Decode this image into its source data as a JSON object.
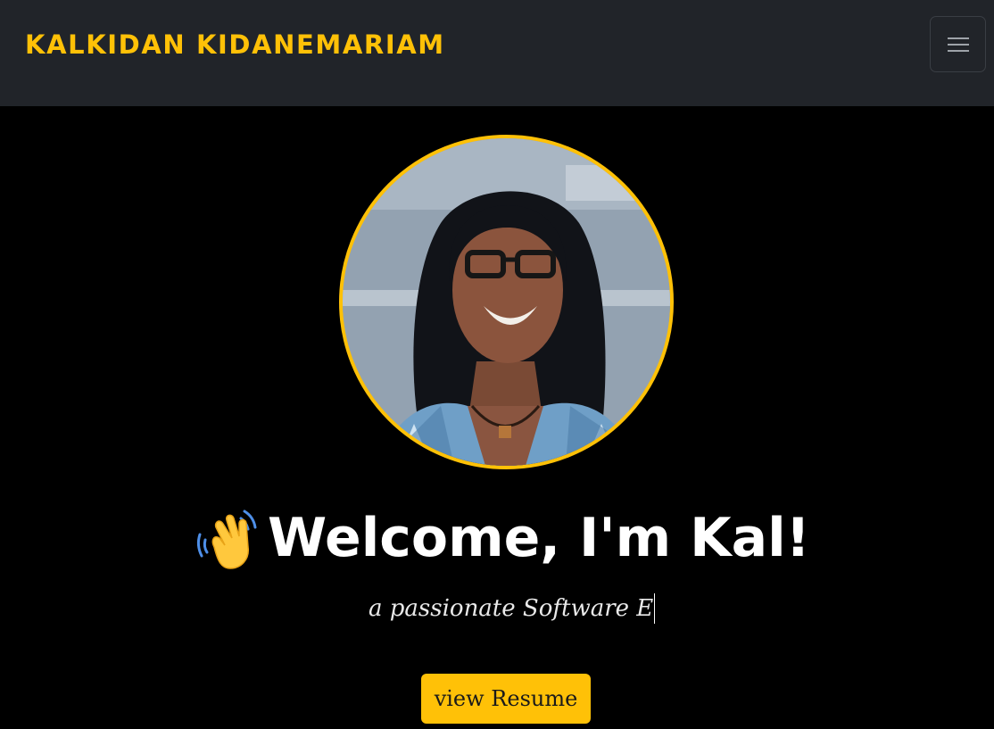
{
  "navbar": {
    "brand": "KALKIDAN KIDANEMARIAM",
    "menu_icon": "hamburger-menu-icon"
  },
  "hero": {
    "avatar_icon": "profile-photo",
    "wave_icon": "waving-hand-icon",
    "heading": "Welcome, I'm Kal!",
    "tagline": "a passionate Software E",
    "resume_button": "view Resume"
  },
  "colors": {
    "accent": "#FFC107",
    "navbar_bg": "#212429",
    "page_bg": "#000000",
    "heading": "#FFFFFF"
  }
}
